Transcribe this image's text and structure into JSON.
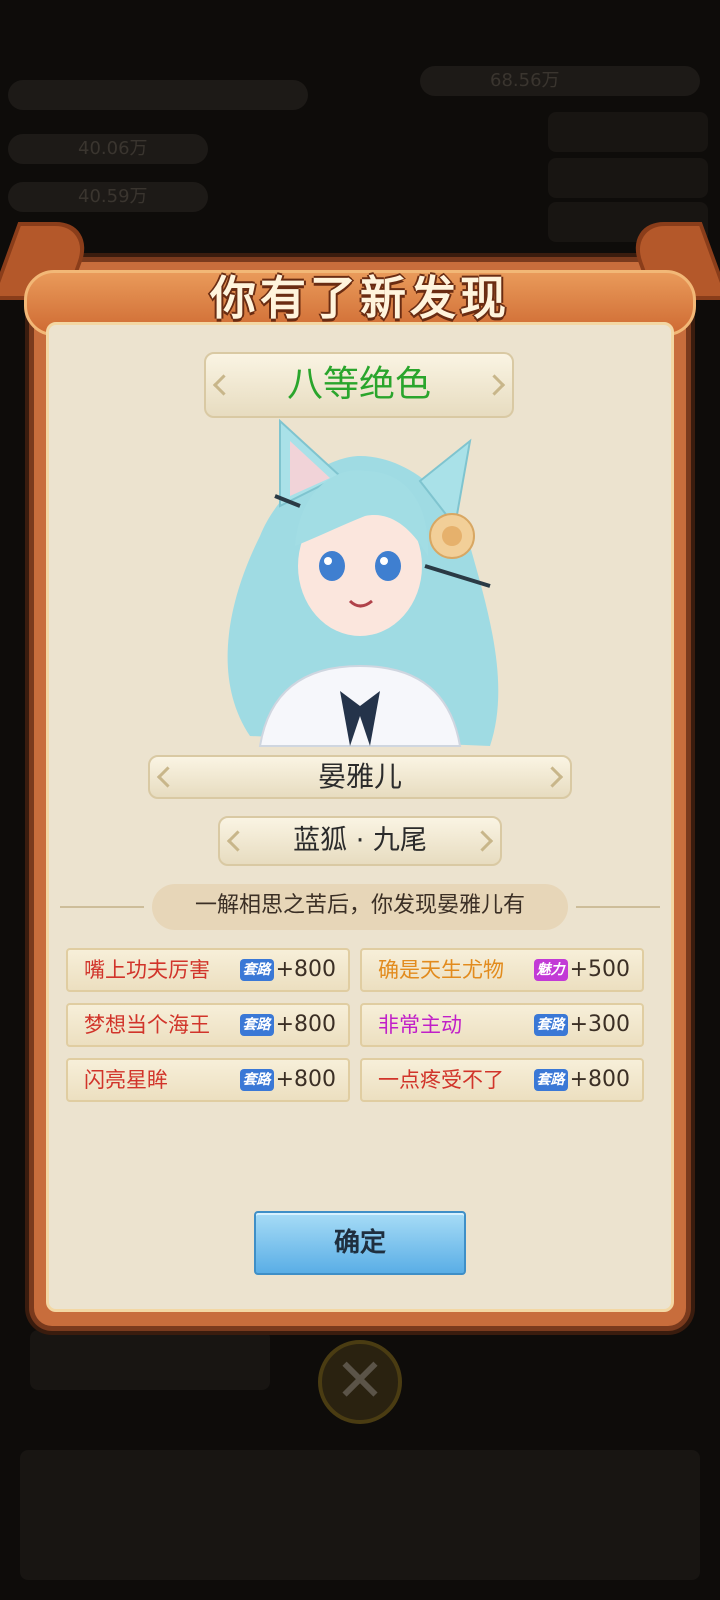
{
  "dialog": {
    "title": "你有了新发现",
    "rank": "八等绝色",
    "rank_color": "#2aa52c",
    "name": "晏雅儿",
    "race": "蓝狐 · 九尾",
    "description": "一解相思之苦后，你发现晏雅儿有",
    "confirm_label": "确定"
  },
  "stat_types": {
    "taolu": {
      "label": "套路",
      "color": "#3a78d6"
    },
    "meili": {
      "label": "魅力",
      "color": "#c23ad6"
    }
  },
  "traits": [
    {
      "label": "嘴上功夫厉害",
      "label_color": "#d1342a",
      "stat_icon": "套路",
      "stat_icon_color": "#3a78d6",
      "value": "+800"
    },
    {
      "label": "确是天生尤物",
      "label_color": "#e28b1d",
      "stat_icon": "魅力",
      "stat_icon_color": "#c23ad6",
      "value": "+500"
    },
    {
      "label": "梦想当个海王",
      "label_color": "#d1342a",
      "stat_icon": "套路",
      "stat_icon_color": "#3a78d6",
      "value": "+800"
    },
    {
      "label": "非常主动",
      "label_color": "#c11fc8",
      "stat_icon": "套路",
      "stat_icon_color": "#3a78d6",
      "value": "+300"
    },
    {
      "label": "闪亮星眸",
      "label_color": "#d1342a",
      "stat_icon": "套路",
      "stat_icon_color": "#3a78d6",
      "value": "+800"
    },
    {
      "label": "一点疼受不了",
      "label_color": "#d1342a",
      "stat_icon": "套路",
      "stat_icon_color": "#3a78d6",
      "value": "+800"
    }
  ],
  "background": {
    "stat_1": "40.06万",
    "stat_2": "40.59万",
    "stat_3": "68.56万",
    "close_icon": "close-icon"
  }
}
